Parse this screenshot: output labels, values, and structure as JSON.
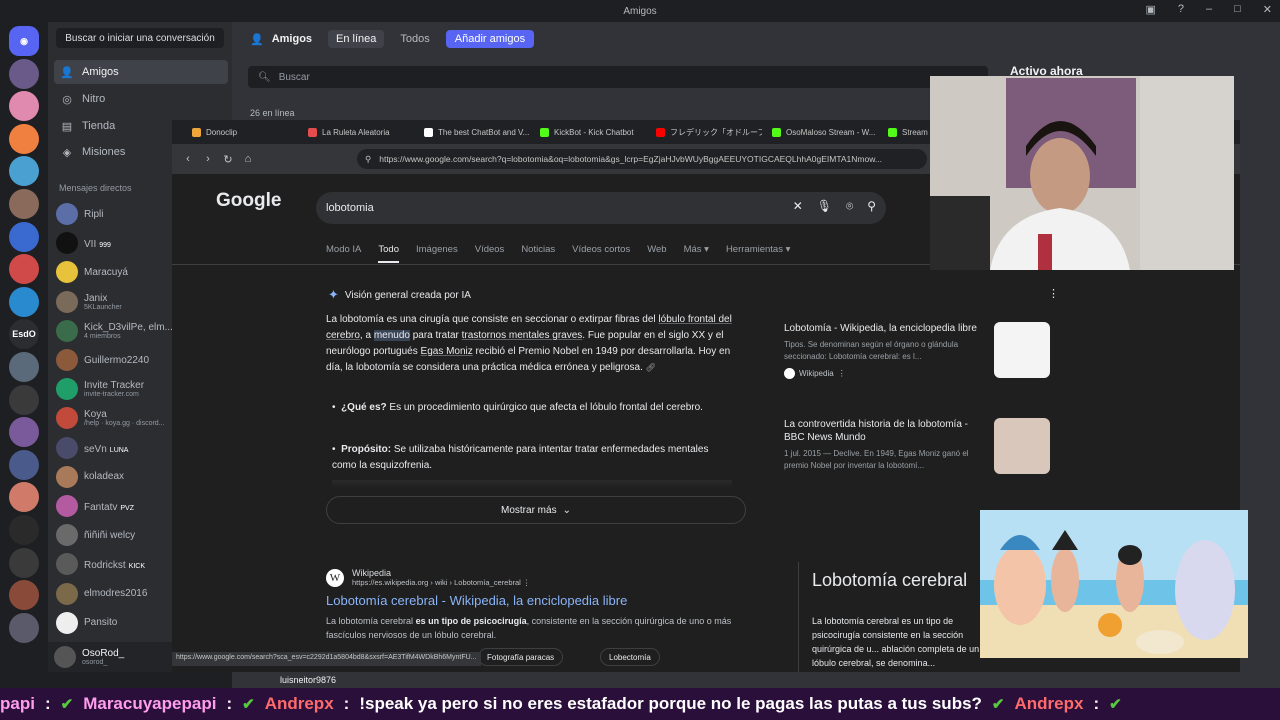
{
  "window": {
    "title": "Amigos"
  },
  "sidebar": {
    "search": "Buscar o iniciar una conversación",
    "nav": [
      {
        "label": "Amigos",
        "icon": "friends-icon"
      },
      {
        "label": "Nitro",
        "icon": "nitro-icon"
      },
      {
        "label": "Tienda",
        "icon": "shop-icon"
      },
      {
        "label": "Misiones",
        "icon": "quests-icon"
      }
    ],
    "dm_header": "Mensajes directos",
    "dms": [
      {
        "name": "Ripli",
        "sub": "",
        "tag": "",
        "color": "#5b6ea8"
      },
      {
        "name": "VII",
        "sub": "",
        "tag": "999",
        "color": "#111111"
      },
      {
        "name": "Maracuyá",
        "sub": "",
        "tag": "",
        "color": "#e6c33a"
      },
      {
        "name": "Janix",
        "sub": "5KLauncher",
        "tag": "",
        "color": "#7a6a5a"
      },
      {
        "name": "Kick_D3vilPe, elm...",
        "sub": "4 miembros",
        "tag": "",
        "color": "#3a6b4a"
      },
      {
        "name": "Guillermo2240",
        "sub": "",
        "tag": "",
        "color": "#8a5a3a"
      },
      {
        "name": "Invite Tracker",
        "sub": "invite-tracker.com",
        "tag": "",
        "color": "#1f9e6a"
      },
      {
        "name": "Koya",
        "sub": "/help · koya.gg · discord...",
        "tag": "",
        "color": "#c24a3a"
      },
      {
        "name": "seVn",
        "sub": "",
        "tag": "LUNA",
        "color": "#4a4a6a"
      },
      {
        "name": "koladeax",
        "sub": "",
        "tag": "",
        "color": "#a87a5a"
      },
      {
        "name": "Fantatv",
        "sub": "",
        "tag": "PVZ",
        "color": "#b45aa0"
      },
      {
        "name": "ñiñiñi welcy",
        "sub": "",
        "tag": "",
        "color": "#6a6a6a"
      },
      {
        "name": "Rodrickst",
        "sub": "",
        "tag": "KICK",
        "color": "#5a5a5a"
      },
      {
        "name": "elmodres2016",
        "sub": "",
        "tag": "",
        "color": "#7a6a4a"
      },
      {
        "name": "Pansito",
        "sub": "",
        "tag": "",
        "color": "#eeeeee"
      }
    ],
    "user": {
      "name": "OsoRod_",
      "status": "osorod_"
    }
  },
  "friends": {
    "title": "Amigos",
    "tabs": [
      "En línea",
      "Todos"
    ],
    "add": "Añadir amigos",
    "search_placeholder": "Buscar",
    "online_count": "26 en línea",
    "active_now": "Activo ahora"
  },
  "browser": {
    "tabs": [
      {
        "label": "Donoclip",
        "color": "#f0a53a"
      },
      {
        "label": "La Ruleta Aleatoria",
        "color": "#e44d4d"
      },
      {
        "label": "The best ChatBot and V...",
        "color": "#ffffff"
      },
      {
        "label": "KickBot - Kick Chatbot",
        "color": "#53fc18"
      },
      {
        "label": "フレデリック「オドループ」",
        "color": "#ff0000"
      },
      {
        "label": "OsoMaloso Stream - W...",
        "color": "#53fc18"
      },
      {
        "label": "Stream - K...",
        "color": "#53fc18"
      }
    ],
    "url": "https://www.google.com/search?q=lobotomia&oq=lobotomia&gs_lcrp=EgZjaHJvbWUyBggAEEUYOTIGCAEQLhhA0gEIMTA1Nmow...",
    "status_url": "https://www.google.com/search?sca_esv=c2292d1a5804bd8&sxsrf=AE3TifM4WDkBh6MyntFU..."
  },
  "google": {
    "logo": "Google",
    "query": "lobotomia",
    "tabs": [
      "Modo IA",
      "Todo",
      "Imágenes",
      "Vídeos",
      "Noticias",
      "Vídeos cortos",
      "Web",
      "Más ▾",
      "Herramientas ▾"
    ],
    "active_tab": "Todo",
    "ai_title": "Visión general creada por IA",
    "ai_p1": "La lobotomía es una cirugía que consiste en seccionar o extirpar fibras del ",
    "ai_p1_link": "lóbulo frontal del cerebro",
    "ai_p1b": ", a ",
    "ai_p1_hl": "menudo",
    "ai_p1c": " para tratar ",
    "ai_p1_link2": "trastornos mentales graves",
    "ai_p1d": ". Fue popular en el siglo XX y el neurólogo portugués ",
    "ai_p1_link3": "Egas Moniz",
    "ai_p1e": " recibió el Premio Nobel en 1949 por desarrollarla. Hoy en día, la lobotomía se considera una práctica médica errónea y peligrosa.",
    "b1_label": "¿Qué es?",
    "b1_text": " Es un procedimiento quirúrgico que afecta el lóbulo frontal del cerebro.",
    "b2_label": "Propósito:",
    "b2_text": " Se utilizaba históricamente para intentar tratar enfermedades mentales como la esquizofrenia.",
    "more": "Mostrar más",
    "sources": [
      {
        "title": "Lobotomía - Wikipedia, la enciclopedia libre",
        "desc": "Tipos. Se denominan según el órgano o glándula seccionado: Lobotomía cerebral: es l...",
        "site": "Wikipedia"
      },
      {
        "title": "La controvertida historia de la lobotomía - BBC News Mundo",
        "desc": "1 jul. 2015 — Declive. En 1949, Egas Moniz ganó el premio Nobel por inventar la lobotomí...",
        "site": ""
      }
    ],
    "result": {
      "site": "Wikipedia",
      "url": "https://es.wikipedia.org › wiki › Lobotomía_cerebral",
      "title": "Lobotomía cerebral - Wikipedia, la enciclopedia libre",
      "snippet_a": "La lobotomía cerebral ",
      "snippet_b": "es un tipo de psicocirugía",
      "snippet_c": ", consistente en la sección quirúrgica de uno o más fascículos nerviosos de un lóbulo cerebral."
    },
    "chips": [
      "Fotografía paracas",
      "Lobectomía"
    ],
    "kp_title": "Lobotomía cerebral",
    "kp_text": "La lobotomía cerebral es un tipo de psicocirugía consistente en la sección quirúrgica de u... ablación completa de un lóbulo cerebral, se denomina..."
  },
  "stream": {
    "strip_user": "luisneitor9876",
    "chat": [
      {
        "user": "papi",
        "msg": "",
        "cls": "u1"
      },
      {
        "user": "Maracuyapepapi",
        "msg": "",
        "cls": "u1"
      },
      {
        "user": "Andrepx",
        "msg": "!speak ya pero si no eres estafador porque no le pagas las putas a tus subs?",
        "cls": "u2"
      },
      {
        "user": "Andrepx",
        "msg": "",
        "cls": "u2"
      }
    ]
  }
}
